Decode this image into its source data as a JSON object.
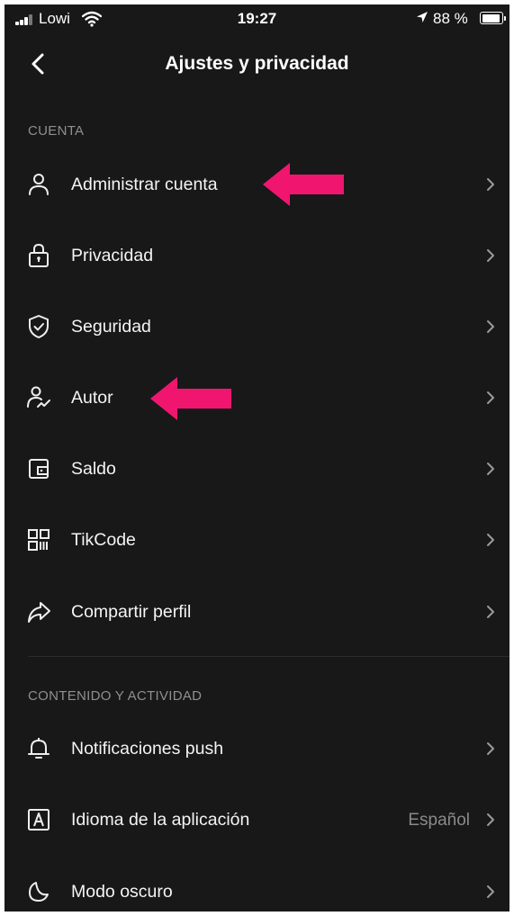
{
  "statusbar": {
    "carrier": "Lowi",
    "time": "19:27",
    "battery": "88 %"
  },
  "navbar": {
    "title": "Ajustes y privacidad"
  },
  "sections": [
    {
      "header": "CUENTA",
      "items": [
        {
          "label": "Administrar cuenta",
          "icon": "person-icon"
        },
        {
          "label": "Privacidad",
          "icon": "lock-icon"
        },
        {
          "label": "Seguridad",
          "icon": "shield-icon"
        },
        {
          "label": "Autor",
          "icon": "creator-icon"
        },
        {
          "label": "Saldo",
          "icon": "wallet-icon"
        },
        {
          "label": "TikCode",
          "icon": "qr-code-icon"
        },
        {
          "label": "Compartir perfil",
          "icon": "share-icon"
        }
      ]
    },
    {
      "header": "CONTENIDO Y ACTIVIDAD",
      "items": [
        {
          "label": "Notificaciones push",
          "icon": "bell-icon"
        },
        {
          "label": "Idioma de la aplicación",
          "value": "Español",
          "icon": "language-icon"
        },
        {
          "label": "Modo oscuro",
          "icon": "moon-icon"
        }
      ]
    }
  ],
  "colors": {
    "background": "#181818",
    "annotation_arrow": "#f0166f",
    "text": "#f4f4f4",
    "muted": "#8f8f8f"
  }
}
